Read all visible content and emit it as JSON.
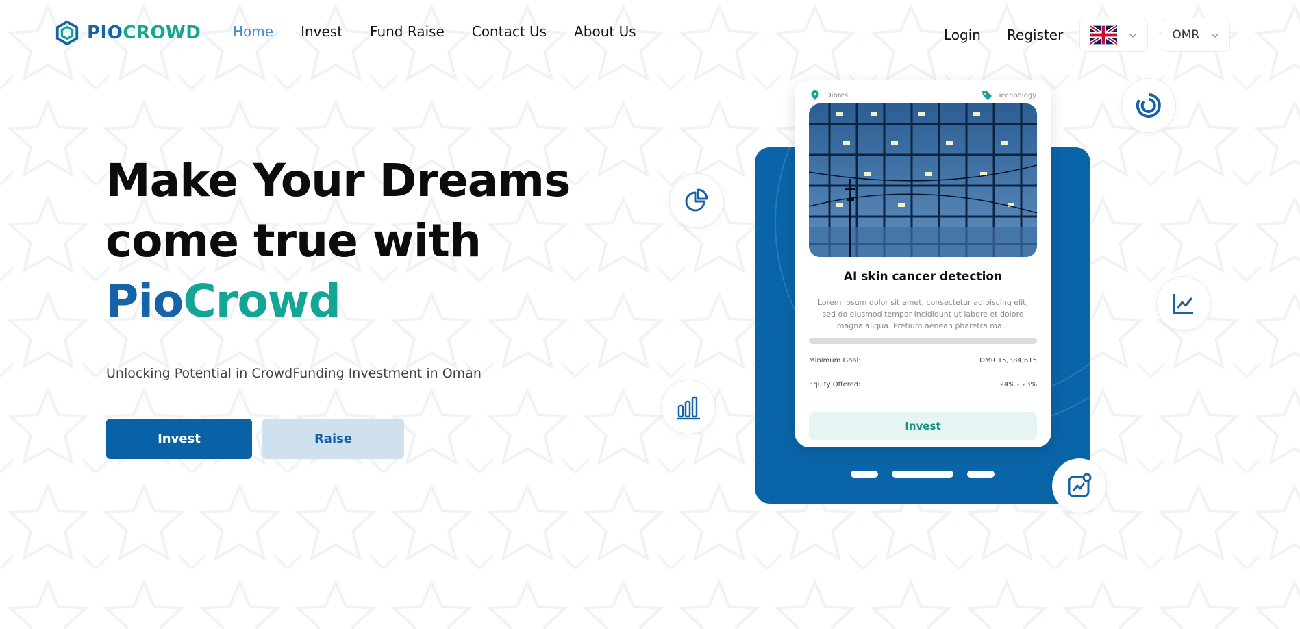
{
  "brand": {
    "name_part1": "PIO",
    "name_part2": "CROWD"
  },
  "nav": {
    "links": [
      {
        "label": "Home",
        "active": true
      },
      {
        "label": "Invest"
      },
      {
        "label": "Fund Raise"
      },
      {
        "label": "Contact Us"
      },
      {
        "label": "About Us"
      }
    ],
    "login_label": "Login",
    "register_label": "Register",
    "language_flag": "uk-flag-icon",
    "currency": "OMR"
  },
  "hero": {
    "title_line1": "Make Your Dreams",
    "title_line2": "come true with",
    "title_brand1": "Pio",
    "title_brand2": "Crowd",
    "subtitle": "Unlocking Potential in CrowdFunding Investment in Oman",
    "invest_label": "Invest",
    "raise_label": "Raise"
  },
  "card": {
    "location": "Dibres",
    "category": "Technology",
    "title": "AI skin cancer detection",
    "description": "Lorem ipsum dolor sit amet, consectetur adipiscing elit, sed do eiusmod tempor incididunt ut labore et dolore magna aliqua. Pretium aenean pharetra ma...",
    "progress_percent": 0,
    "min_goal_label": "Minimum Goal:",
    "min_goal_value": "OMR 15,384,615",
    "equity_label": "Equity Offered:",
    "equity_value": "24% - 23%",
    "invest_label": "Invest"
  },
  "colors": {
    "brand_blue": "#1763a8",
    "brand_teal": "#14a597",
    "panel_blue": "#0a64a8",
    "active_link": "#4a8ccc"
  },
  "floating_icons": [
    "pie-chart-icon",
    "donut-chart-icon",
    "line-chart-icon",
    "bar-chart-icon",
    "chart-settings-icon"
  ]
}
